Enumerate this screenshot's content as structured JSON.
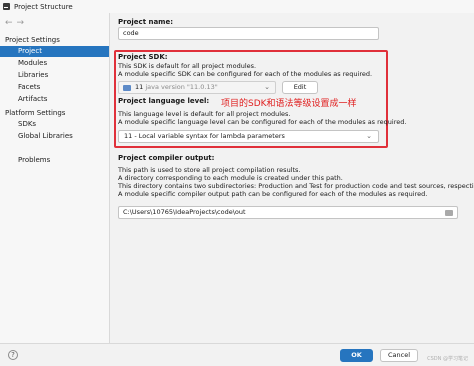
{
  "window": {
    "title": "Project Structure"
  },
  "sidebar": {
    "section1": "Project Settings",
    "items1": [
      "Project",
      "Modules",
      "Libraries",
      "Facets",
      "Artifacts"
    ],
    "section2": "Platform Settings",
    "items2": [
      "SDKs",
      "Global Libraries"
    ],
    "problems": "Problems"
  },
  "main": {
    "name_label": "Project name:",
    "name_value": "code",
    "sdk_label": "Project SDK:",
    "sdk_desc1": "This SDK is default for all project modules.",
    "sdk_desc2": "A module specific SDK can be configured for each of the modules as required.",
    "sdk_select_main": "11",
    "sdk_select_version": "java version \"11.0.13\"",
    "edit_button": "Edit",
    "lang_label": "Project language level:",
    "lang_desc1": "This language level is default for all project modules.",
    "lang_desc2": "A module specific language level can be configured for each of the modules as required.",
    "lang_value": "11 - Local variable syntax for lambda parameters",
    "annotation": "项目的SDK和语法等级设置成一样",
    "output_label": "Project compiler output:",
    "output_desc1": "This path is used to store all project compilation results.",
    "output_desc2": "A directory corresponding to each module is created under this path.",
    "output_desc3": "This directory contains two subdirectories: Production and Test for production code and test sources, respectively.",
    "output_desc4": "A module specific compiler output path can be configured for each of the modules as required.",
    "output_path": "C:\\Users\\10765\\IdeaProjects\\code\\out"
  },
  "footer": {
    "help": "?",
    "ok": "OK",
    "cancel": "Cancel",
    "watermark": "CSDN @学习笔记"
  }
}
